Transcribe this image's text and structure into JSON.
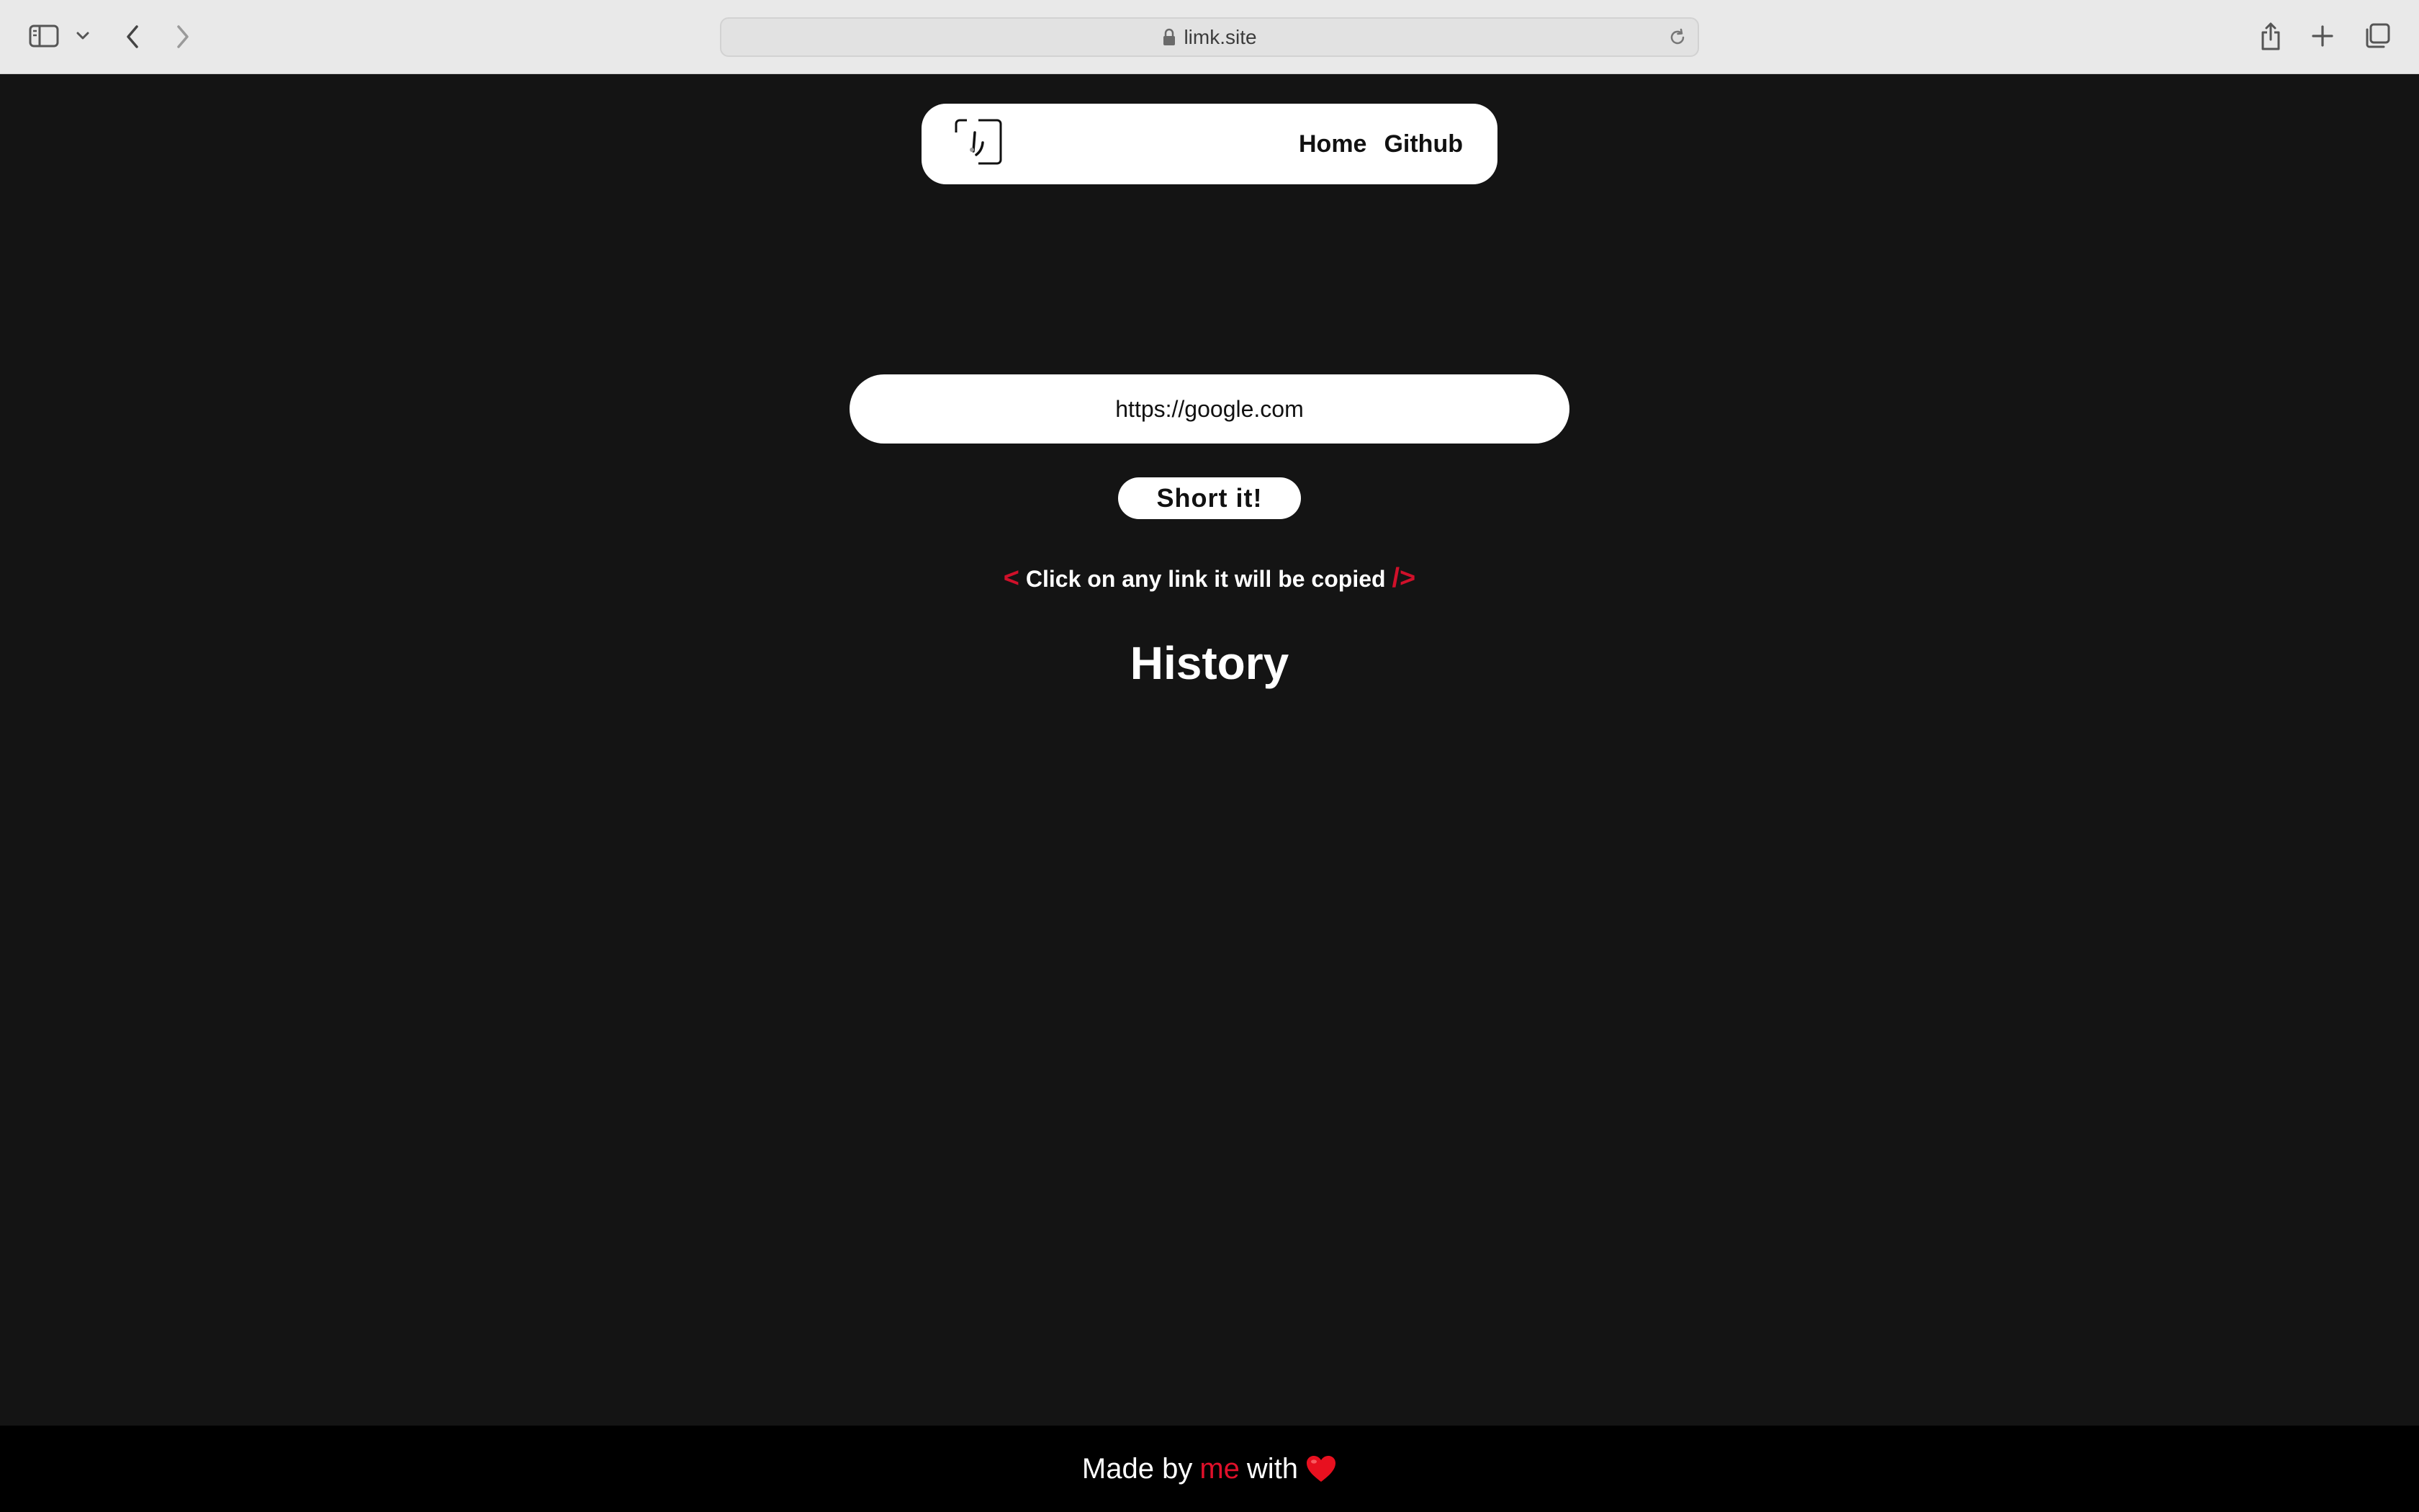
{
  "browser": {
    "url": "limk.site",
    "icons": {
      "sidebar": "sidebar-icon",
      "sidebar_dropdown": "chevron-down-icon",
      "back": "chevron-left-icon",
      "forward": "chevron-right-icon",
      "lock": "lock-icon",
      "reload": "reload-icon",
      "share": "share-icon",
      "new_tab": "plus-icon",
      "tabs": "tab-overview-icon"
    }
  },
  "nav": {
    "logo": "logo-icon",
    "links": [
      "Home",
      "Github"
    ]
  },
  "form": {
    "url_value": "https://google.com",
    "submit_label": "Short it!"
  },
  "hint": {
    "open": "<",
    "text": "Click on any link it will be copied",
    "close": "/>"
  },
  "history": {
    "title": "History"
  },
  "footer": {
    "made_by": "Made by",
    "me": "me",
    "with": "with",
    "heart": "heart-icon"
  },
  "colors": {
    "background": "#141414",
    "accent": "#d0102a",
    "footer_bg": "#000000",
    "surface": "#ffffff"
  }
}
